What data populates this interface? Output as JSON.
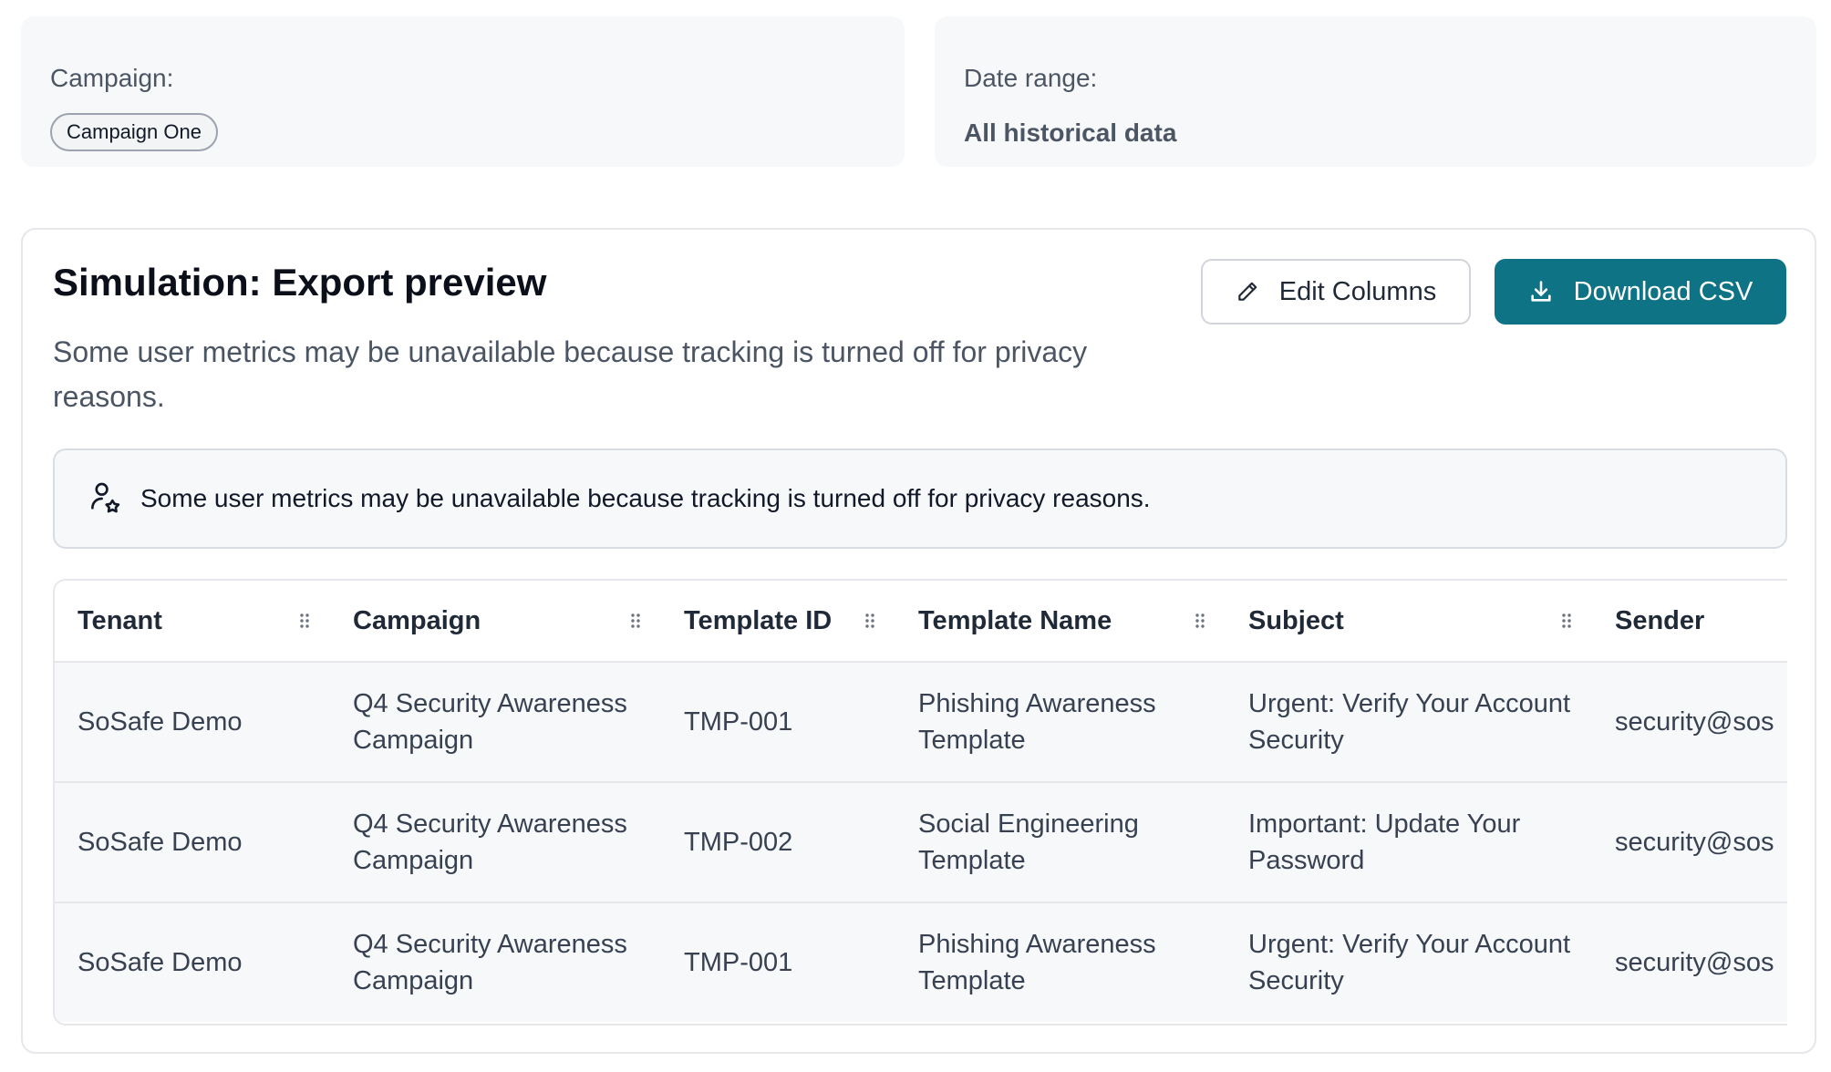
{
  "filters": {
    "campaign": {
      "label": "Campaign:",
      "chip": "Campaign One"
    },
    "date_range": {
      "label": "Date range:",
      "value": "All historical data"
    }
  },
  "panel": {
    "title": "Simulation: Export preview",
    "subtitle": "Some user metrics may be unavailable because tracking is turned off for privacy reasons.",
    "edit_columns_label": "Edit Columns",
    "download_label": "Download CSV",
    "notice": "Some user metrics may be unavailable because tracking is turned off for privacy reasons."
  },
  "table": {
    "columns": [
      "Tenant",
      "Campaign",
      "Template ID",
      "Template Name",
      "Subject",
      "Sender"
    ],
    "rows": [
      [
        "SoSafe Demo",
        "Q4 Security Awareness Campaign",
        "TMP-001",
        "Phishing Awareness Template",
        "Urgent: Verify Your Account Security",
        "security@sos"
      ],
      [
        "SoSafe Demo",
        "Q4 Security Awareness Campaign",
        "TMP-002",
        "Social Engineering Template",
        "Important: Update Your Password",
        "security@sos"
      ],
      [
        "SoSafe Demo",
        "Q4 Security Awareness Campaign",
        "TMP-001",
        "Phishing Awareness Template",
        "Urgent: Verify Your Account Security",
        "security@sos"
      ]
    ]
  },
  "colors": {
    "primary": "#0e7384",
    "card_bg": "#f7f8fa",
    "border": "#e5e7eb"
  },
  "icons": {
    "edit": "pencil-icon",
    "download": "download-icon",
    "notice": "user-privacy-icon",
    "column": "drag-handle-icon"
  }
}
